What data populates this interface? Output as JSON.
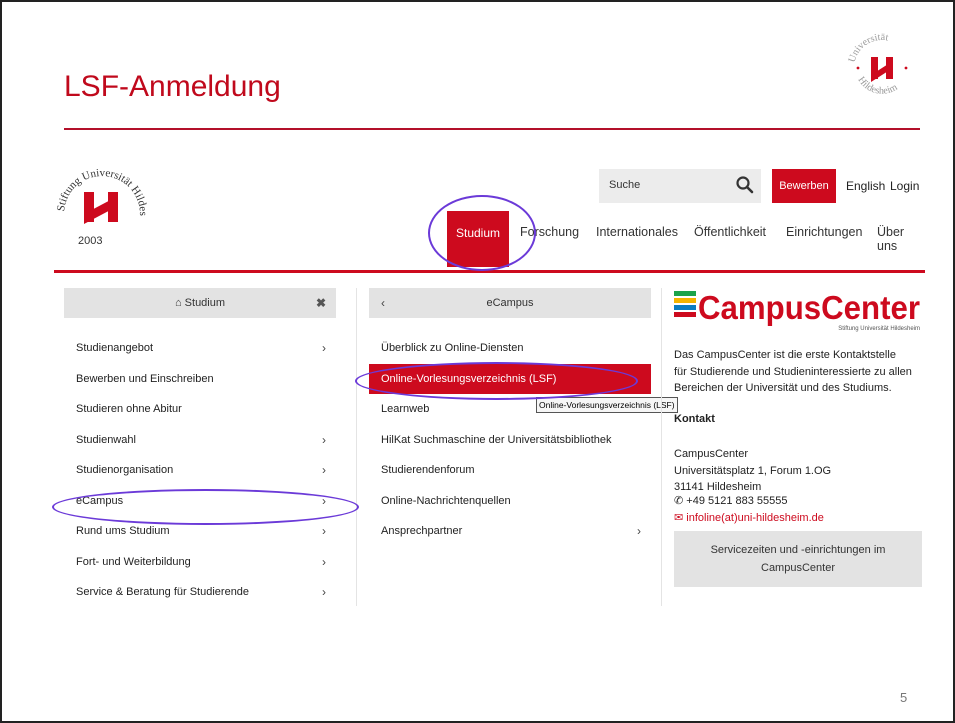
{
  "slide": {
    "title": "LSF-Anmeldung",
    "page_number": "5",
    "logo_text_top": "Universität",
    "logo_text_bottom": "Hildesheim"
  },
  "site": {
    "logo_ring_text": "Stiftung Universität Hildesheim",
    "logo_year": "2003",
    "search_placeholder": "Suche",
    "apply_label": "Bewerben",
    "english_label": "English",
    "login_label": "Login",
    "nav": [
      "Studium",
      "Forschung",
      "Internationales",
      "Öffentlichkeit",
      "Einrichtungen",
      "Über uns"
    ]
  },
  "col1": {
    "header": "Studium",
    "items": [
      {
        "label": "Studienangebot",
        "chev": "›"
      },
      {
        "label": "Bewerben und Einschreiben",
        "chev": ""
      },
      {
        "label": "Studieren ohne Abitur",
        "chev": ""
      },
      {
        "label": "Studienwahl",
        "chev": "›"
      },
      {
        "label": "Studienorganisation",
        "chev": "›"
      },
      {
        "label": "eCampus",
        "chev": "›"
      },
      {
        "label": "Rund ums Studium",
        "chev": "›"
      },
      {
        "label": "Fort- und Weiterbildung",
        "chev": "›"
      },
      {
        "label": "Service & Beratung für Studierende",
        "chev": "›"
      }
    ]
  },
  "col2": {
    "header": "eCampus",
    "back": "‹",
    "items": [
      {
        "label": "Überblick zu Online-Diensten",
        "chev": ""
      },
      {
        "label": "Online-Vorlesungsverzeichnis (LSF)",
        "chev": ""
      },
      {
        "label": "Learnweb",
        "chev": ""
      },
      {
        "label": "HilKat Suchmaschine der Universitätsbibliothek",
        "chev": ""
      },
      {
        "label": "Studierendenforum",
        "chev": ""
      },
      {
        "label": "Online-Nachrichtenquellen",
        "chev": ""
      },
      {
        "label": "Ansprechpartner",
        "chev": "›"
      }
    ],
    "tooltip": "Online-Vorlesungsverzeichnis (LSF)"
  },
  "campus_center": {
    "logo_word": "CampusCenter",
    "logo_sub": "Stiftung Universität Hildesheim",
    "description": [
      "Das CampusCenter ist die erste Kontaktstelle",
      "für Studierende und Studieninteressierte zu allen",
      "Bereichen der Universität und des Studiums."
    ],
    "contact_heading": "Kontakt",
    "address": [
      "CampusCenter",
      "Universitätsplatz 1, Forum 1.OG",
      "31141 Hildesheim"
    ],
    "phone": "+49 5121 883 55555",
    "email": "infoline(at)uni-hildesheim.de",
    "service_button": [
      "Servicezeiten und -einrichtungen im",
      "CampusCenter"
    ]
  },
  "colors": {
    "accent_red": "#cd0a1e",
    "annotation_purple": "#6b3ad8"
  }
}
